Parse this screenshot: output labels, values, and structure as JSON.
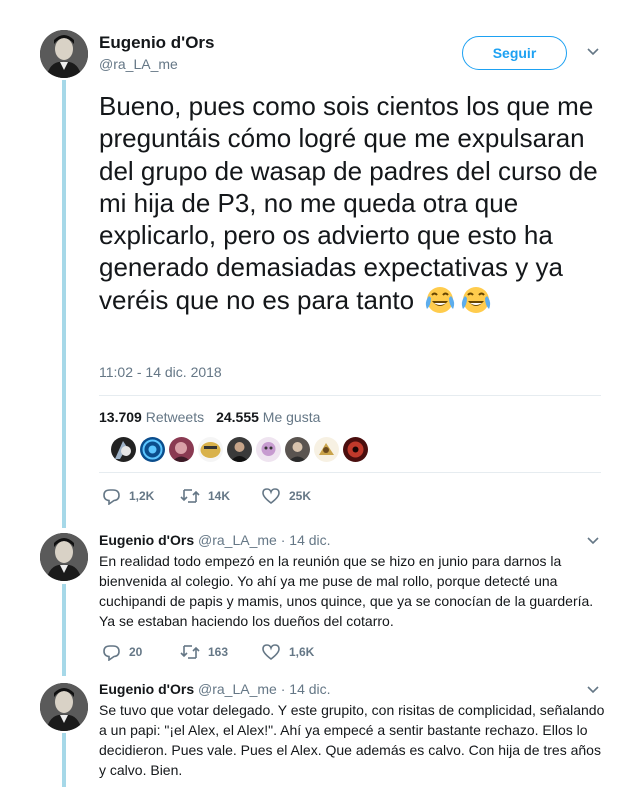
{
  "main_tweet": {
    "author_name": "Eugenio d'Ors",
    "author_handle": "@ra_LA_me",
    "follow_label": "Seguir",
    "text": "Bueno, pues como sois cientos los que me preguntáis cómo logré que me expulsaran del grupo de wasap de padres del curso de mi hija de P3, no me queda otra que explicarlo, pero os advierto que esto ha generado demasiadas expectativas y ya veréis que no es para tanto",
    "emojis": [
      "face-with-tears-of-joy-icon",
      "face-with-tears-of-joy-icon"
    ],
    "timestamp": "11:02 - 14 dic. 2018",
    "retweets_count": "13.709",
    "retweets_label": "Retweets",
    "likes_count": "24.555",
    "likes_label": "Me gusta",
    "liker_avatars": 9,
    "actions": {
      "replies": "1,2K",
      "retweets": "14K",
      "likes": "25K"
    }
  },
  "replies": [
    {
      "author_name": "Eugenio d'Ors",
      "author_handle": "@ra_LA_me",
      "separator": "·",
      "date": "14 dic.",
      "text": "En realidad todo empezó en la reunión que se hizo en junio para darnos la bienvenida al colegio. Yo ahí ya me puse de mal rollo, porque detecté una cuchipandi de papis y mamis, unos quince, que ya se conocían de la guardería. Ya se estaban haciendo los dueños del cotarro.",
      "actions": {
        "replies": "20",
        "retweets": "163",
        "likes": "1,6K"
      }
    },
    {
      "author_name": "Eugenio d'Ors",
      "author_handle": "@ra_LA_me",
      "separator": "·",
      "date": "14 dic.",
      "text": "Se tuvo que votar delegado. Y este grupito, con risitas de complicidad, señalando a un papi: \"¡el Alex, el Alex!\". Ahí ya empecé a sentir bastante rechazo. Ellos lo decidieron. Pues vale. Pues el Alex. Que además es calvo. Con hija de tres años y calvo. Bien."
    }
  ],
  "colors": {
    "accent": "#1da1f2",
    "thread_line": "#a6d8e8",
    "secondary_text": "#657786",
    "primary_text": "#14171a",
    "divider": "#e6ecf0"
  }
}
